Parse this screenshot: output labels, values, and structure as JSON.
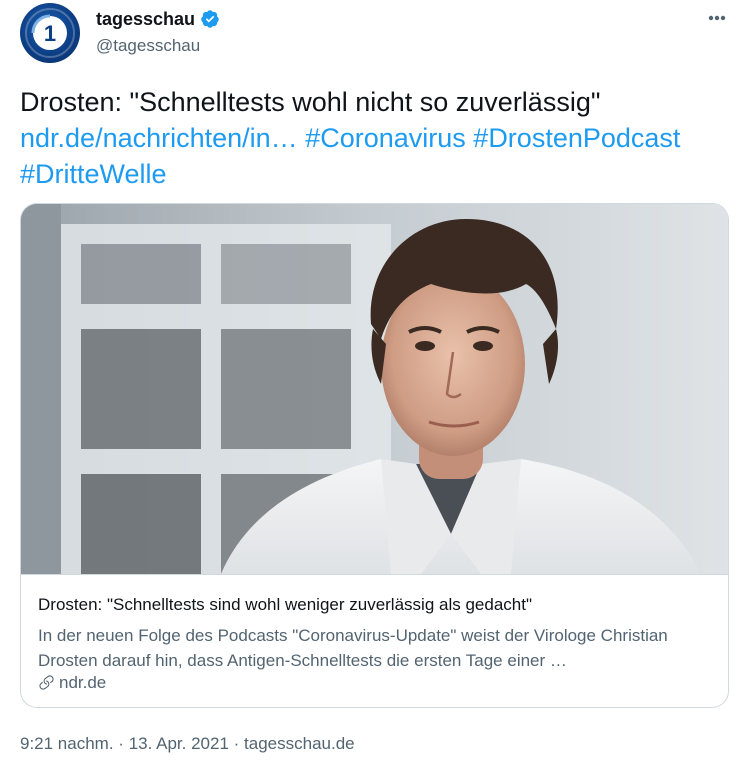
{
  "author": {
    "name": "tagesschau",
    "handle": "@tagesschau",
    "verified": true,
    "avatar_icon": "tagesschau-logo"
  },
  "menu_icon": "more-horizontal-icon",
  "tweet": {
    "text": "Drosten: \"Schnelltests wohl nicht so zuverlässig\"",
    "link": "ndr.de/nachrichten/in…",
    "hashtags": [
      "#Coronavirus",
      "#DrostenPodcast",
      "#DritteWelle"
    ]
  },
  "card": {
    "title": "Drosten: \"Schnelltests sind wohl weniger zuverlässig als gedacht\"",
    "description": "In der neuen Folge des Podcasts \"Coronavirus-Update\" weist der Virologe Christian Drosten darauf hin, dass Antigen-Schnelltests die ersten Tage einer …",
    "domain": "ndr.de"
  },
  "footer": {
    "time": "9:21 nachm.",
    "separator": "·",
    "date": "13. Apr. 2021",
    "source": "tagesschau.de"
  },
  "colors": {
    "link": "#1d9bf0",
    "secondary_text": "#536471",
    "border": "#cfd9de"
  }
}
